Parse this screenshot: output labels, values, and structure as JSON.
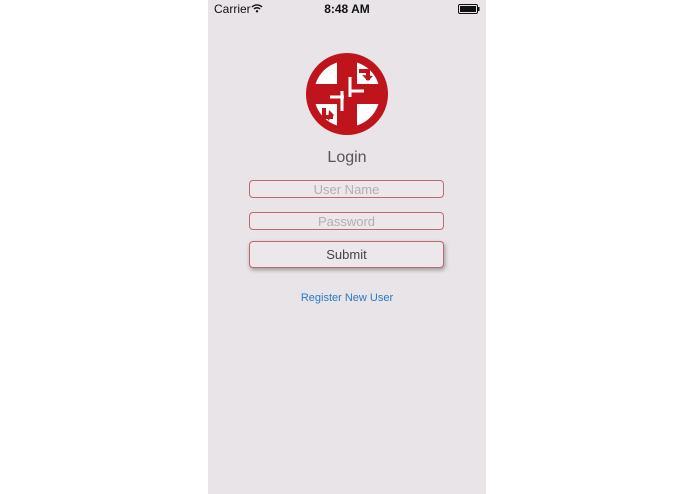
{
  "status_bar": {
    "carrier": "Carrier",
    "time": "8:48 AM",
    "wifi_icon": "wifi-icon",
    "battery_icon": "battery-icon"
  },
  "logo": {
    "icon": "medical-cross-logo-icon",
    "color": "#c0141c"
  },
  "login": {
    "title": "Login",
    "username_placeholder": "User Name",
    "username_value": "",
    "password_placeholder": "Password",
    "password_value": "",
    "submit_label": "Submit",
    "register_label": "Register New User"
  },
  "colors": {
    "background": "#e8e4e7",
    "field_border": "#c06a6f",
    "link": "#2a7ac4"
  }
}
